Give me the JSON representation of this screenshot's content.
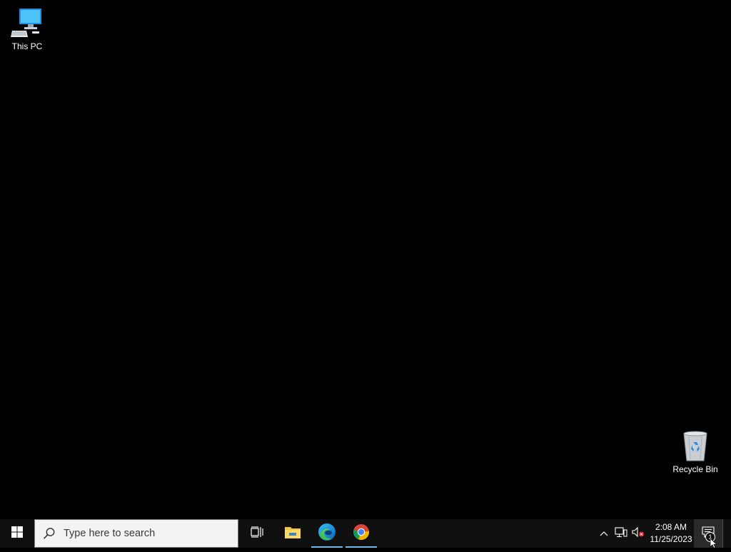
{
  "desktop": {
    "background": "#000000",
    "icons": [
      {
        "label": "This PC",
        "icon": "this-pc-icon"
      },
      {
        "label": "Recycle Bin",
        "icon": "recycle-bin-icon"
      }
    ]
  },
  "taskbar": {
    "background": "#101010",
    "start": {
      "icon": "windows-logo-icon"
    },
    "search": {
      "placeholder": "Type here to search",
      "icon": "search-icon"
    },
    "task_view": {
      "icon": "task-view-icon"
    },
    "pinned_apps": [
      {
        "name": "File Explorer",
        "icon": "file-explorer-icon",
        "running": false
      },
      {
        "name": "Microsoft Edge",
        "icon": "edge-icon",
        "running": true
      },
      {
        "name": "Google Chrome",
        "icon": "chrome-icon",
        "running": true
      }
    ],
    "tray": {
      "icons": [
        "chevron-up-icon",
        "network-icon",
        "volume-muted-icon"
      ],
      "time": "2:08 AM",
      "date": "11/25/2023",
      "notifications": {
        "icon": "action-center-icon",
        "count": "1"
      }
    },
    "accent": "#76b9ed"
  }
}
